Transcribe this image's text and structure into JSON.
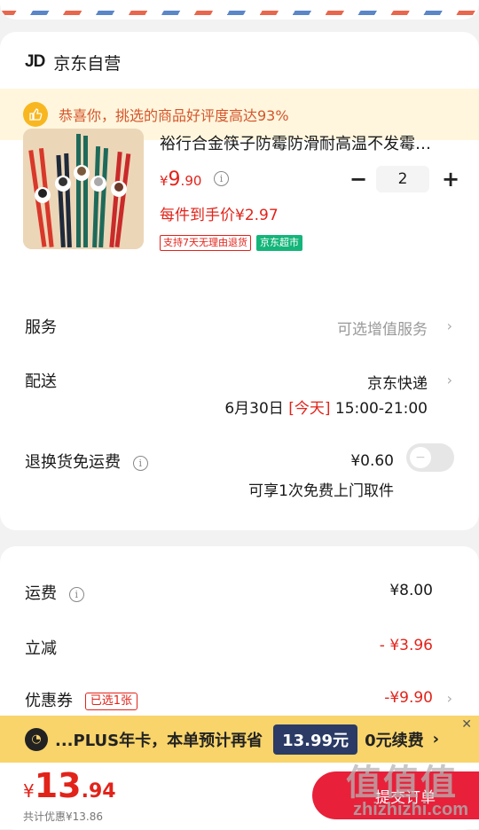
{
  "shop": {
    "logo": "JD",
    "name": "京东自营"
  },
  "praise": {
    "text": "恭喜你，挑选的商品好评度高达93%",
    "icon": "thumb-up-icon"
  },
  "product": {
    "title": "裕行合金筷子防霉防滑耐高温不发霉…",
    "price_currency": "¥",
    "price_int": "9",
    "price_dec": ".90",
    "quantity": "2",
    "minus": "−",
    "plus": "+",
    "hand_price": "每件到手价¥2.97",
    "tag_return": "支持7天无理由退货",
    "tag_market": "京东超市"
  },
  "service": {
    "label": "服务",
    "value": "可选增值服务"
  },
  "delivery": {
    "label": "配送",
    "value": "京东快递",
    "date": "6月30日",
    "today": "[今天]",
    "time": "15:00-21:00"
  },
  "return_freight": {
    "label": "退换货免运费",
    "price": "¥0.60",
    "desc": "可享1次免费上门取件",
    "enabled": false
  },
  "fees": {
    "shipping_label": "运费",
    "shipping_value": "¥8.00",
    "discount_label": "立减",
    "discount_value": "- ¥3.96",
    "coupon_label": "优惠券",
    "coupon_tag": "已选1张",
    "coupon_value": "-¥9.90"
  },
  "plus": {
    "text_pre": "...PLUS年卡，本单预计再省",
    "amount": "13.99元",
    "text_post": "0元续费",
    "arrow": "›",
    "close": "✕"
  },
  "footer": {
    "currency": "¥",
    "total_int": "13",
    "total_dec": ".94",
    "saved": "共计优惠¥13.86",
    "submit": "提交订单"
  },
  "watermark": {
    "cn": "值值值",
    "en": "zhizhizhi.com"
  },
  "colors": {
    "accent_red": "#e2231a",
    "plus_gold": "#f8d46a",
    "praise_bg": "#fff6dd",
    "green_tag": "#14b57a"
  }
}
